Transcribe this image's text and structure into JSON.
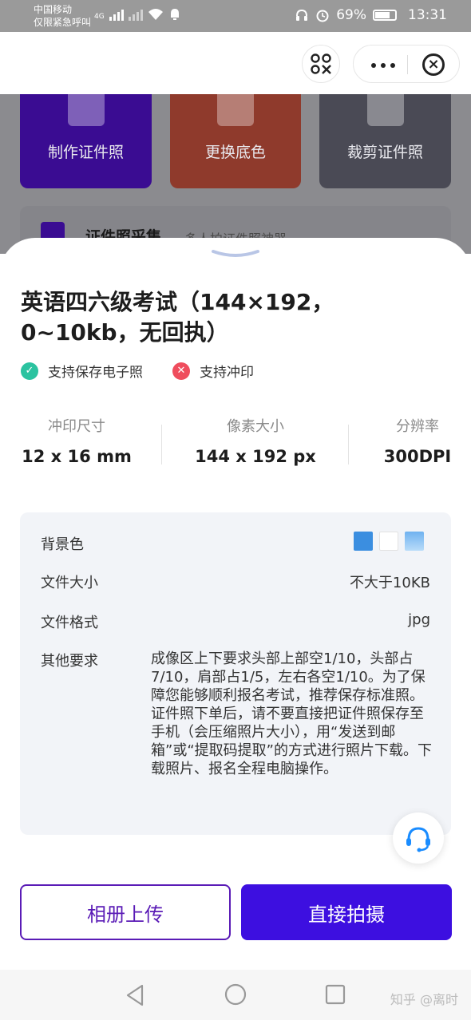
{
  "status_bar": {
    "carrier_line1": "中国移动",
    "carrier_line2": "仅限紧急呼叫",
    "network": "4G",
    "battery": "69%",
    "time": "13:31"
  },
  "background": {
    "tiles": [
      {
        "label": "制作证件照"
      },
      {
        "label": "更换底色"
      },
      {
        "label": "裁剪证件照"
      }
    ],
    "banner_title": "证件照采集",
    "banner_subtitle": "多人拍证件照神器"
  },
  "sheet": {
    "title": "英语四六级考试（144×192，0~10kb，无回执）",
    "features": [
      {
        "label": "支持保存电子照",
        "icon": "check-icon",
        "color": "#2bc3a0"
      },
      {
        "label": "支持冲印",
        "icon": "cross-icon",
        "color": "#ef4d5d"
      }
    ],
    "specs": [
      {
        "label": "冲印尺寸",
        "value": "12 x 16 mm"
      },
      {
        "label": "像素大小",
        "value": "144 x 192 px"
      },
      {
        "label": "分辨率",
        "value": "300DPI"
      }
    ],
    "details": {
      "bg_label": "背景色",
      "bg_colors": [
        "#3b8ee0",
        "#ffffff",
        "#8fc6f5"
      ],
      "size_label": "文件大小",
      "size_value": "不大于10KB",
      "format_label": "文件格式",
      "format_value": "jpg",
      "other_label": "其他要求",
      "other_value": "成像区上下要求头部上部空1/10，头部占7/10，肩部占1/5，左右各空1/10。为了保障您能够顺利报名考试，推荐保存标准照。证件照下单后，请不要直接把证件照保存至手机（会压缩照片大小），用“发送到邮箱”或“提取码提取”的方式进行照片下载。下载照片、报名全程电脑操作。"
    },
    "upload_button": "相册上传",
    "shoot_button": "直接拍摄"
  },
  "watermark": "知乎 @离时",
  "colors": {
    "accent": "#3d0fe0",
    "accent_outline": "#5a1bb6"
  }
}
